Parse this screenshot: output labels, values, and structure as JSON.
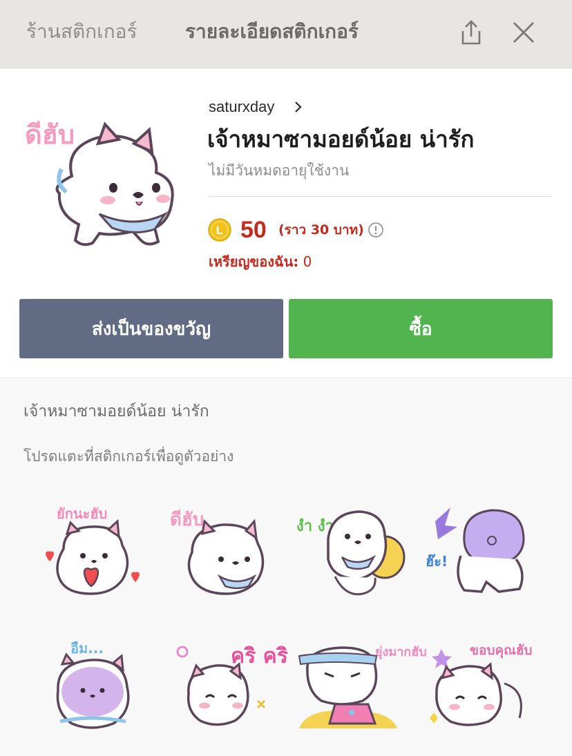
{
  "header": {
    "tab_store": "ร้านสติกเกอร์",
    "tab_detail": "รายละเอียดสติกเกอร์",
    "share_icon": "share-icon",
    "close_icon": "close-icon"
  },
  "pack": {
    "hero_caption": "ดีฮับ",
    "creator": "saturxday",
    "title": "เจ้าหมาซามอยด์น้อย น่ารัก",
    "validity": "ไม่มีวันหมดอายุใช้งาน",
    "coin_letter": "L",
    "price": "50",
    "price_approx": "(ราว  30 บาท)",
    "my_coins_label": "เหรียญของฉัน:",
    "my_coins_value": "0"
  },
  "actions": {
    "gift_label": "ส่งเป็นของขวัญ",
    "buy_label": "ซื้อ"
  },
  "preview": {
    "title": "เจ้าหมาซามอยด์น้อย น่ารัก",
    "hint": "โปรดแตะที่สติกเกอร์เพื่อดูตัวอย่าง",
    "stickers": [
      {
        "caption": "ยักนะฮับ"
      },
      {
        "caption": "ดีฮับ"
      },
      {
        "caption": "งำ งำ"
      },
      {
        "caption": "ฮ๊ะ!"
      },
      {
        "caption": "อืม..."
      },
      {
        "caption": "คริ คริ"
      },
      {
        "caption": "ยุ่งมากฮับ"
      },
      {
        "caption": "ขอบคุณฮับ"
      }
    ]
  },
  "colors": {
    "header_bg": "#e7e6e2",
    "price_red": "#c22a1e",
    "gift_button": "#626b84",
    "buy_button": "#52b44e",
    "coin_gold": "#f2c21a"
  }
}
